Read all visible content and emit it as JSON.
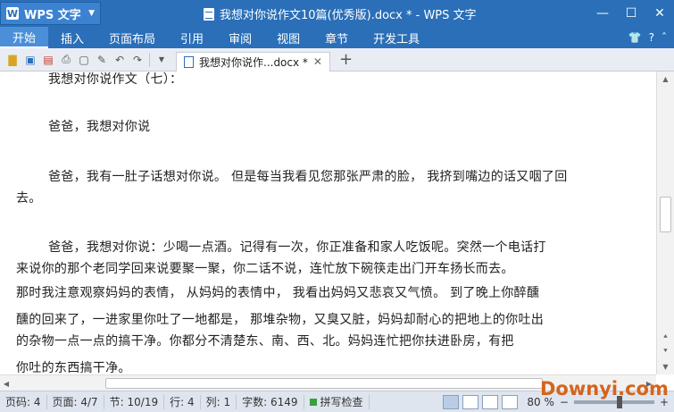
{
  "window": {
    "app_button": "WPS 文字",
    "title": "我想对你说作文10篇(优秀版).docx * - WPS 文字",
    "controls": [
      "—",
      "☐",
      "✕"
    ]
  },
  "menu": {
    "items": [
      "开始",
      "插入",
      "页面布局",
      "引用",
      "审阅",
      "视图",
      "章节",
      "开发工具"
    ],
    "active": "开始"
  },
  "toolbar": {
    "doc_tab_label": "我想对你说作...docx *",
    "add_tab": "+"
  },
  "document": {
    "lines": [
      "我想对你说作文（七）：",
      "爸爸，我想对你说",
      "爸爸，我有一肚子话想对你说。  但是每当我看见您那张严肃的脸，  我挤到嘴边的话又咽了回",
      "去。",
      "爸爸，我想对你说：少喝一点酒。记得有一次，你正准备和家人吃饭呢。突然一个电话打",
      "来说你的那个老同学回来说要聚一聚，你二话不说，连忙放下碗筷走出门开车扬长而去。",
      "那时我注意观察妈妈的表情，    从妈妈的表情中，    我看出妈妈又悲哀又气愤。    到了晚上你醉醺",
      "醺的回来了，一进家里你吐了一地都是，  那堆杂物，又臭又脏，妈妈却耐心的把地上的你吐出",
      "的杂物一点一点的搞干净。你都分不清楚东、南、西、北。妈妈连忙把你扶进卧房，有把",
      "你吐的东西搞干净。"
    ]
  },
  "status": {
    "page_num": "页码: 4",
    "page": "页面: 4/7",
    "section": "节: 10/19",
    "row": "行: 4",
    "col": "列: 1",
    "word_count": "字数: 6149",
    "spell_check": "拼写检查",
    "zoom": "80 %",
    "zoom_level_percent": 80
  },
  "watermark": "Downyi.com"
}
